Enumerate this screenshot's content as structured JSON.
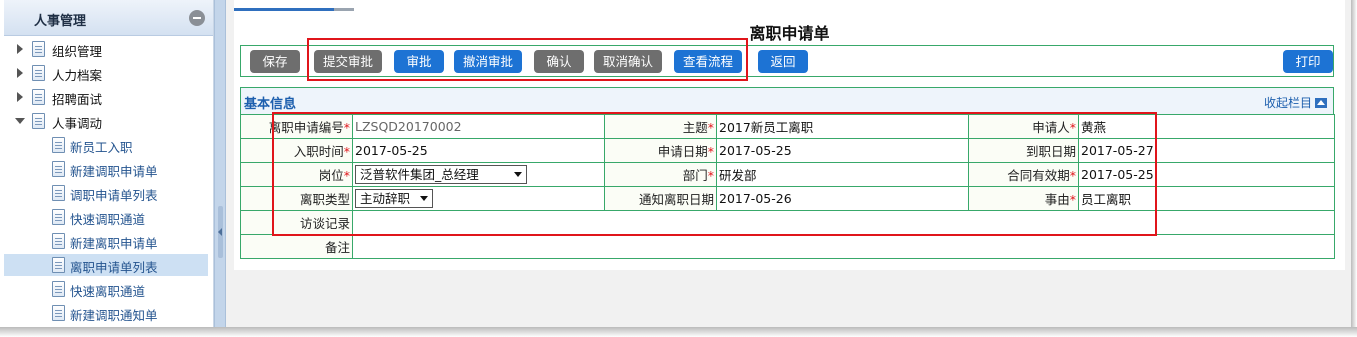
{
  "sidebar": {
    "title": "人事管理",
    "items": [
      {
        "label": "组织管理",
        "level": 1,
        "expanded": false
      },
      {
        "label": "人力档案",
        "level": 1,
        "expanded": false
      },
      {
        "label": "招聘面试",
        "level": 1,
        "expanded": false
      },
      {
        "label": "人事调动",
        "level": 1,
        "expanded": true
      },
      {
        "label": "新员工入职",
        "level": 2
      },
      {
        "label": "新建调职申请单",
        "level": 2
      },
      {
        "label": "调职申请单列表",
        "level": 2
      },
      {
        "label": "快速调职通道",
        "level": 2
      },
      {
        "label": "新建离职申请单",
        "level": 2
      },
      {
        "label": "离职申请单列表",
        "level": 2,
        "selected": true
      },
      {
        "label": "快速离职通道",
        "level": 2
      },
      {
        "label": "新建调职通知单",
        "level": 2
      }
    ]
  },
  "page": {
    "title": "离职申请单",
    "toolbar": {
      "save": "保存",
      "submit": "提交审批",
      "approve": "审批",
      "cancel_approve": "撤消审批",
      "confirm": "确认",
      "cancel_confirm": "取消确认",
      "view_flow": "查看流程",
      "back": "返回",
      "print": "打印"
    },
    "section": {
      "title": "基本信息",
      "collapse": "收起栏目"
    },
    "required_mark": "*",
    "form": {
      "resign_no_label": "离职申请编号",
      "resign_no": "LZSQD20170002",
      "subject_label": "主题",
      "subject": "2017新员工离职",
      "applicant_label": "申请人",
      "applicant": "黄燕",
      "join_date_label": "入职时间",
      "join_date": "2017-05-25",
      "apply_date_label": "申请日期",
      "apply_date": "2017-05-25",
      "arrive_date_label": "到职日期",
      "arrive_date": "2017-05-27",
      "position_label": "岗位",
      "position": "泛普软件集团_总经理",
      "department_label": "部门",
      "department": "研发部",
      "contract_valid_label": "合同有效期",
      "contract_valid": "2017-05-25",
      "resign_type_label": "离职类型",
      "resign_type": "主动辞职",
      "notice_date_label": "通知离职日期",
      "notice_date": "2017-05-26",
      "reason_label": "事由",
      "reason": "员工离职",
      "interview_label": "访谈记录",
      "remark_label": "备注"
    }
  },
  "colors": {
    "accent_blue": "#1d73d4",
    "button_gray": "#6e6e6e",
    "table_border": "#38a86a",
    "highlight_red": "#e0151b"
  }
}
